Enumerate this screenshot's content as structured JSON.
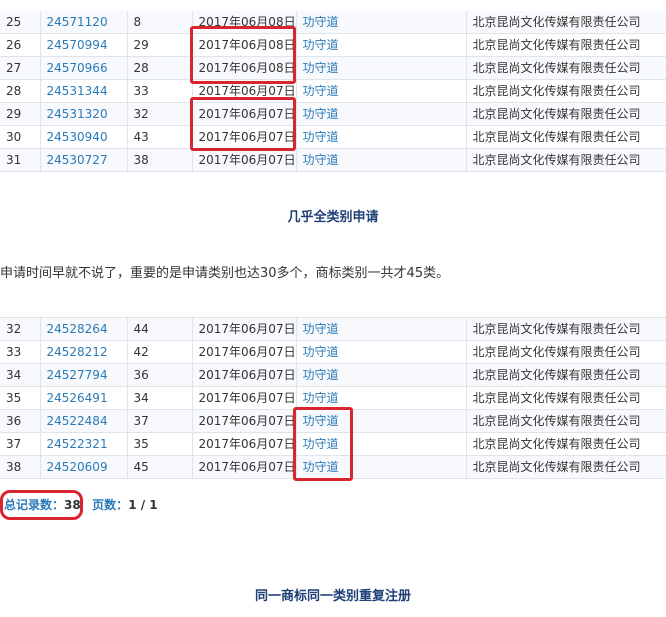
{
  "table1": {
    "rows": [
      [
        "25",
        "24571120",
        "8",
        "2017年06月08日",
        "功守道",
        "北京昆尚文化传媒有限责任公司"
      ],
      [
        "26",
        "24570994",
        "29",
        "2017年06月08日",
        "功守道",
        "北京昆尚文化传媒有限责任公司"
      ],
      [
        "27",
        "24570966",
        "28",
        "2017年06月08日",
        "功守道",
        "北京昆尚文化传媒有限责任公司"
      ],
      [
        "28",
        "24531344",
        "33",
        "2017年06月07日",
        "功守道",
        "北京昆尚文化传媒有限责任公司"
      ],
      [
        "29",
        "24531320",
        "32",
        "2017年06月07日",
        "功守道",
        "北京昆尚文化传媒有限责任公司"
      ],
      [
        "30",
        "24530940",
        "43",
        "2017年06月07日",
        "功守道",
        "北京昆尚文化传媒有限责任公司"
      ],
      [
        "31",
        "24530727",
        "38",
        "2017年06月07日",
        "功守道",
        "北京昆尚文化传媒有限责任公司"
      ]
    ]
  },
  "caption1": "几乎全类别申请",
  "paragraph": "申请时间早就不说了，重要的是申请类别也达30多个，商标类别一共才45类。",
  "table2": {
    "rows": [
      [
        "32",
        "24528264",
        "44",
        "2017年06月07日",
        "功守道",
        "北京昆尚文化传媒有限责任公司"
      ],
      [
        "33",
        "24528212",
        "42",
        "2017年06月07日",
        "功守道",
        "北京昆尚文化传媒有限责任公司"
      ],
      [
        "34",
        "24527794",
        "36",
        "2017年06月07日",
        "功守道",
        "北京昆尚文化传媒有限责任公司"
      ],
      [
        "35",
        "24526491",
        "34",
        "2017年06月07日",
        "功守道",
        "北京昆尚文化传媒有限责任公司"
      ],
      [
        "36",
        "24522484",
        "37",
        "2017年06月07日",
        "功守道",
        "北京昆尚文化传媒有限责任公司"
      ],
      [
        "37",
        "24522321",
        "35",
        "2017年06月07日",
        "功守道",
        "北京昆尚文化传媒有限责任公司"
      ],
      [
        "38",
        "24520609",
        "45",
        "2017年06月07日",
        "功守道",
        "北京昆尚文化传媒有限责任公司"
      ]
    ]
  },
  "pager": {
    "total_label": "总记录数：",
    "total_value": "38",
    "pages_label": "页数：",
    "pages_value": "1 / 1"
  },
  "caption2": "同一商标同一类别重复注册",
  "colors": {
    "link": "#2a7ab8",
    "highlight": "#d9252f",
    "caption": "#1f3f77"
  }
}
